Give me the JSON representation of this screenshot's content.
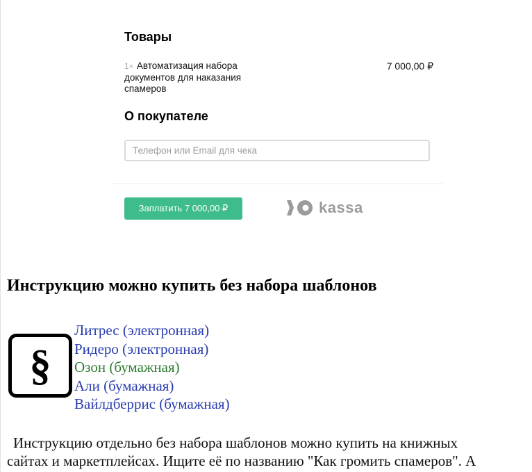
{
  "checkout": {
    "goods_title": "Товары",
    "item": {
      "quantity": "1",
      "multiplier": "×",
      "name": "Автоматизация набора документов для наказания спамеров",
      "price": "7 000,00 ₽"
    },
    "buyer_title": "О покупателе",
    "contact_placeholder": "Телефон или Email для чека",
    "contact_value": "",
    "pay_button_label": "Заплатить 7 000,00 ₽",
    "logo_text": "kassa",
    "logo_icon": "yookassa-logo-icon",
    "accent_color": "#3ebc8c"
  },
  "article": {
    "heading": "Инструкцию можно купить без набора шаблонов",
    "icon": "section-sign-icon",
    "stores": [
      {
        "label": "Литрес (электронная)",
        "color": "#2a3cb0"
      },
      {
        "label": "Ридеро (электронная)",
        "color": "#2a3cb0"
      },
      {
        "label": "Озон (бумажная)",
        "color": "#2e7d32"
      },
      {
        "label": "Али (бумажная)",
        "color": "#2a3cb0"
      },
      {
        "label": "Вайлдберрис (бумажная)",
        "color": "#2a3cb0"
      }
    ],
    "paragraph_line1": "Инструкцию отдельно без набора шаблонов можно купить на книжных",
    "paragraph_line2": "сайтах и маркетплейсах. Ищите её по названию \"Как громить спамеров\". А"
  }
}
